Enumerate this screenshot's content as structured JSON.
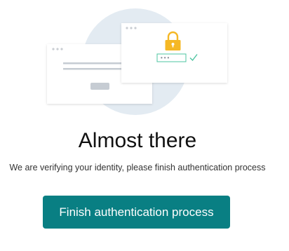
{
  "heading": "Almost there",
  "message": "We are verifying your identity, please finish authentication process",
  "primary_button": "Finish authentication process",
  "illustration": {
    "password_mask": "•••"
  },
  "colors": {
    "accent": "#097f83",
    "lock": "#f5b825",
    "check": "#4cc4a0",
    "circle": "#e3ebf2"
  }
}
